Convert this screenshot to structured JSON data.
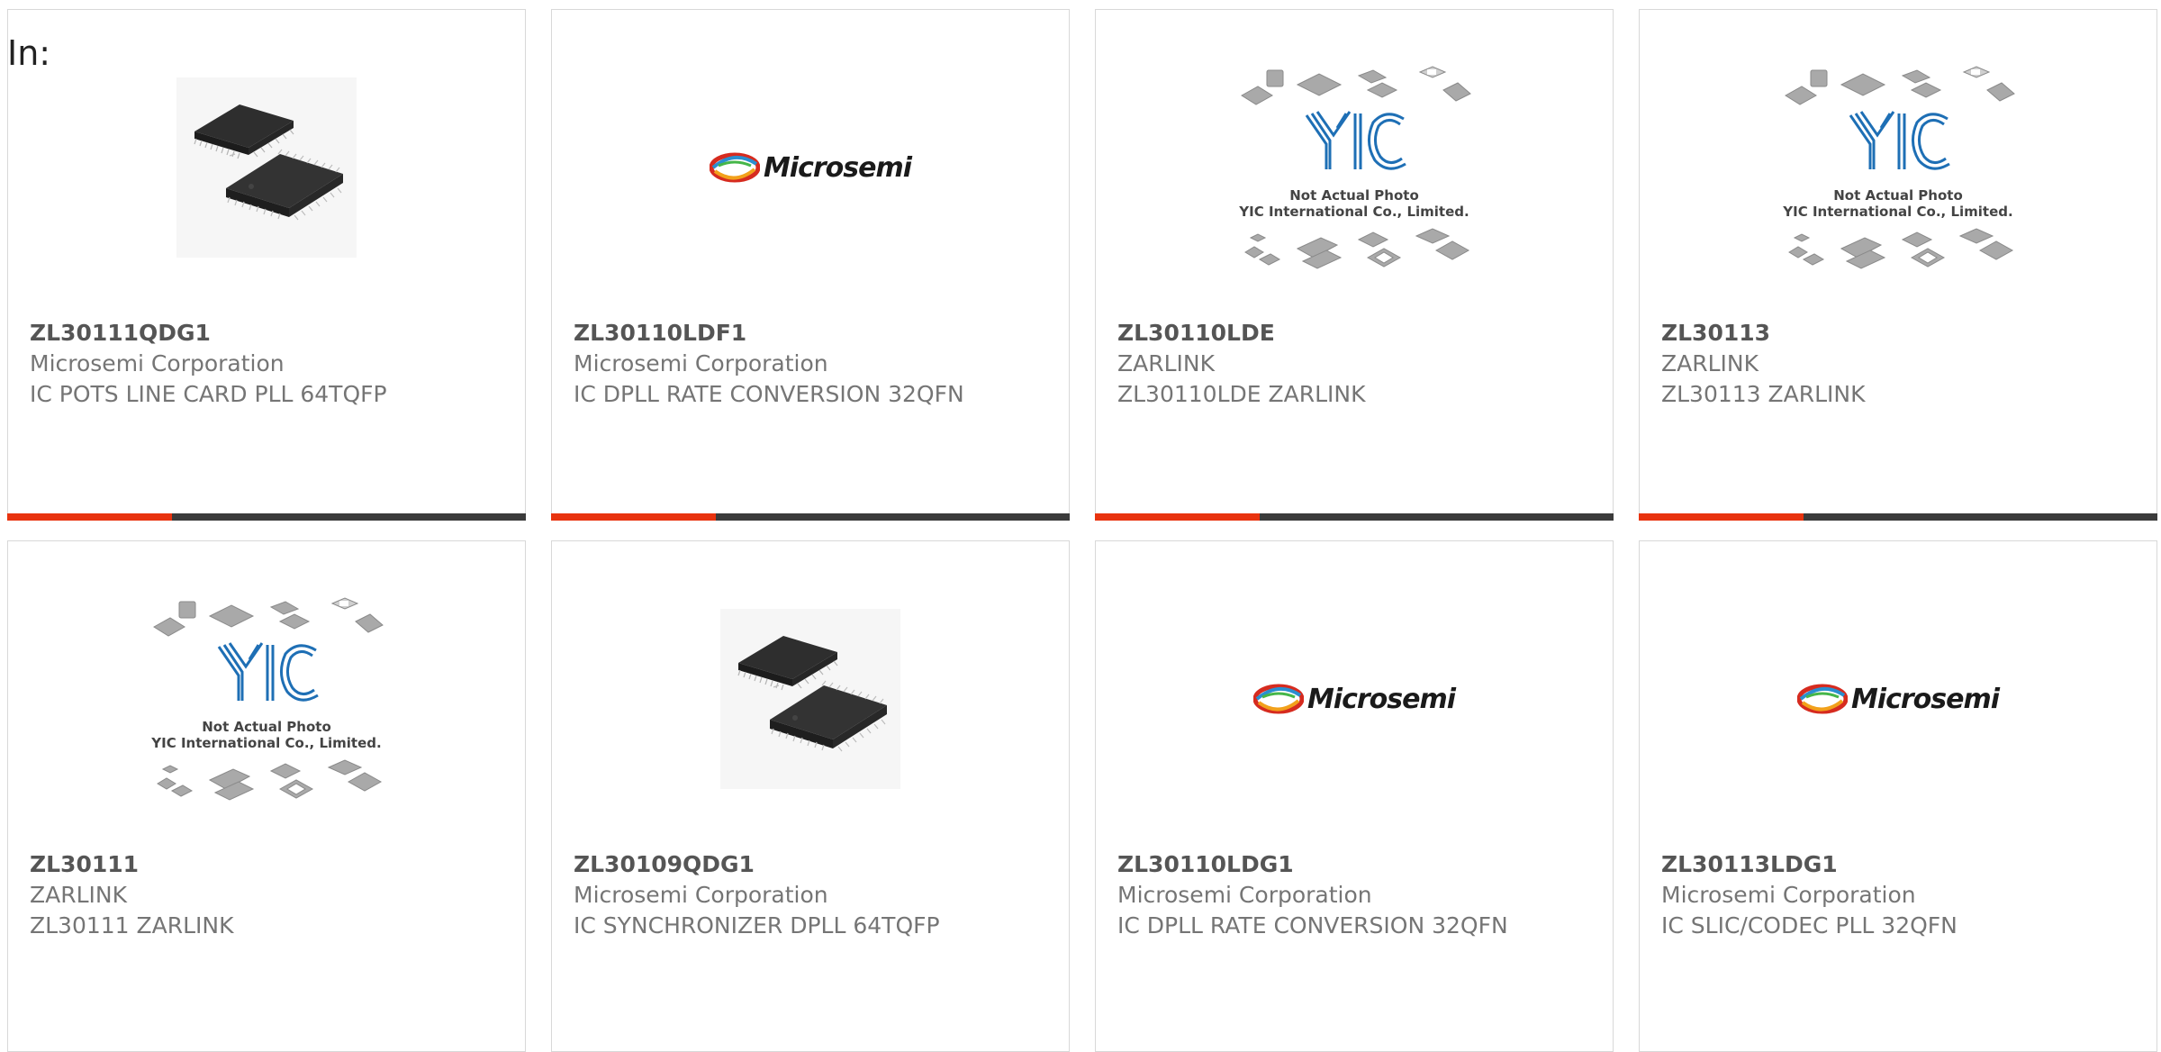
{
  "filter": {
    "in_label": "In:"
  },
  "products": [
    {
      "part_number": "ZL30111QDG1",
      "manufacturer": "Microsemi Corporation",
      "description": "IC POTS LINE CARD PLL 64TQFP",
      "image": "chip-photo",
      "has_bar": true
    },
    {
      "part_number": "ZL30110LDF1",
      "manufacturer": "Microsemi Corporation",
      "description": "IC DPLL RATE CONVERSION 32QFN",
      "image": "microsemi-logo",
      "has_bar": true
    },
    {
      "part_number": "ZL30110LDE",
      "manufacturer": "ZARLINK",
      "description": "ZL30110LDE ZARLINK",
      "image": "yic-placeholder",
      "has_bar": true
    },
    {
      "part_number": "ZL30113",
      "manufacturer": "ZARLINK",
      "description": "ZL30113 ZARLINK",
      "image": "yic-placeholder",
      "has_bar": true
    },
    {
      "part_number": "ZL30111",
      "manufacturer": "ZARLINK",
      "description": "ZL30111 ZARLINK",
      "image": "yic-placeholder",
      "has_bar": false
    },
    {
      "part_number": "ZL30109QDG1",
      "manufacturer": "Microsemi Corporation",
      "description": "IC SYNCHRONIZER DPLL 64TQFP",
      "image": "chip-photo",
      "has_bar": false
    },
    {
      "part_number": "ZL30110LDG1",
      "manufacturer": "Microsemi Corporation",
      "description": "IC DPLL RATE CONVERSION 32QFN",
      "image": "microsemi-logo",
      "has_bar": false
    },
    {
      "part_number": "ZL30113LDG1",
      "manufacturer": "Microsemi Corporation",
      "description": "IC SLIC/CODEC PLL 32QFN",
      "image": "microsemi-logo",
      "has_bar": false
    }
  ],
  "logo_text": {
    "microsemi": "Microsemi",
    "yic_mark": "YIC",
    "yic_caption_line1": "Not Actual Photo",
    "yic_caption_line2": "YIC International Co., Limited."
  },
  "colors": {
    "accent": "#e8330f",
    "bar_dark": "#3b3b3b",
    "yic_blue": "#1e6fb5"
  }
}
